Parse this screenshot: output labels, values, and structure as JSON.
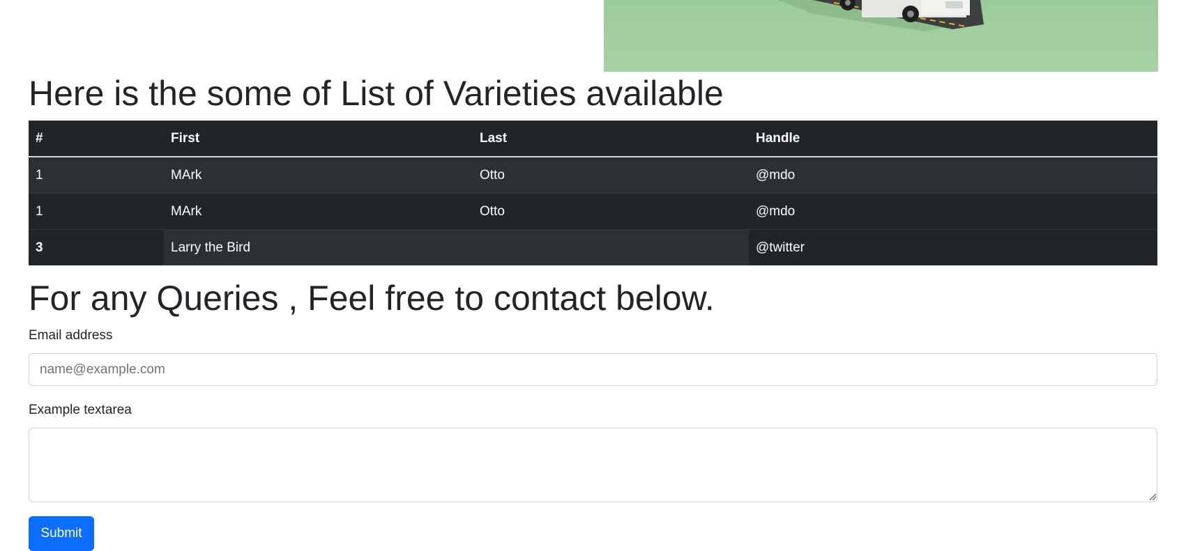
{
  "hero": {
    "image_icon": "food-truck-image"
  },
  "varieties": {
    "title": "Here is the some of List of Varieties available",
    "headers": [
      "#",
      "First",
      "Last",
      "Handle"
    ],
    "rows": [
      {
        "num": "1",
        "first": "MArk",
        "last": "Otto",
        "handle": "@mdo"
      },
      {
        "num": "1",
        "first": "MArk",
        "last": "Otto",
        "handle": "@mdo"
      },
      {
        "num": "3",
        "merged": "Larry the Bird",
        "handle": "@twitter"
      }
    ]
  },
  "contact": {
    "title": "For any Queries , Feel free to contact below.",
    "email_label": "Email address",
    "email_placeholder": "name@example.com",
    "email_value": "",
    "textarea_label": "Example textarea",
    "textarea_value": "",
    "submit_label": "Submit"
  },
  "colors": {
    "table_dark": "#212529",
    "table_stripe": "#2c3034",
    "primary": "#0d6efd",
    "hero_green": "#a3cfa0"
  }
}
